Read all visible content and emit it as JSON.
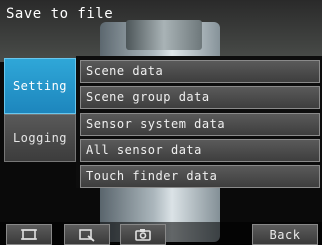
{
  "header": {
    "title": "Save to file"
  },
  "tabs": [
    {
      "label": "Setting",
      "active": true
    },
    {
      "label": "Logging",
      "active": false
    }
  ],
  "menu": {
    "items": [
      {
        "label": "Scene data"
      },
      {
        "label": "Scene group data"
      },
      {
        "label": "Sensor system data"
      },
      {
        "label": "All sensor data"
      },
      {
        "label": "Touch finder data"
      }
    ]
  },
  "toolbar": {
    "icons": [
      "display-mode-icon",
      "zoom-icon",
      "camera-icon"
    ],
    "back_label": "Back"
  },
  "colors": {
    "accent": "#1d86bd",
    "button": "#4a4a4a",
    "text": "#ffffff"
  }
}
